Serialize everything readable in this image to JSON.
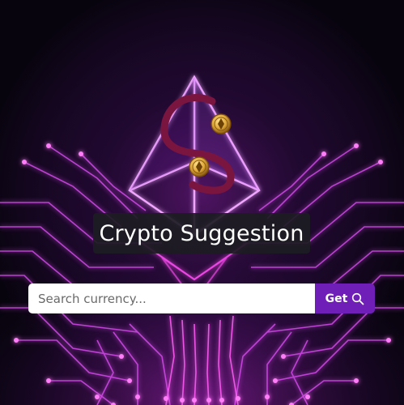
{
  "app": {
    "title": "Crypto Suggestion"
  },
  "search": {
    "placeholder": "Search currency...",
    "value": ""
  },
  "get_button": {
    "label": "Get",
    "icon": "search-icon"
  },
  "colors": {
    "accent": "#6f1fb8",
    "neon_pink": "#ff3df2",
    "neon_purple": "#b14dff",
    "logo_maroon": "#7a1540",
    "coin_gold": "#e0a93a",
    "background": "#0a0612"
  }
}
